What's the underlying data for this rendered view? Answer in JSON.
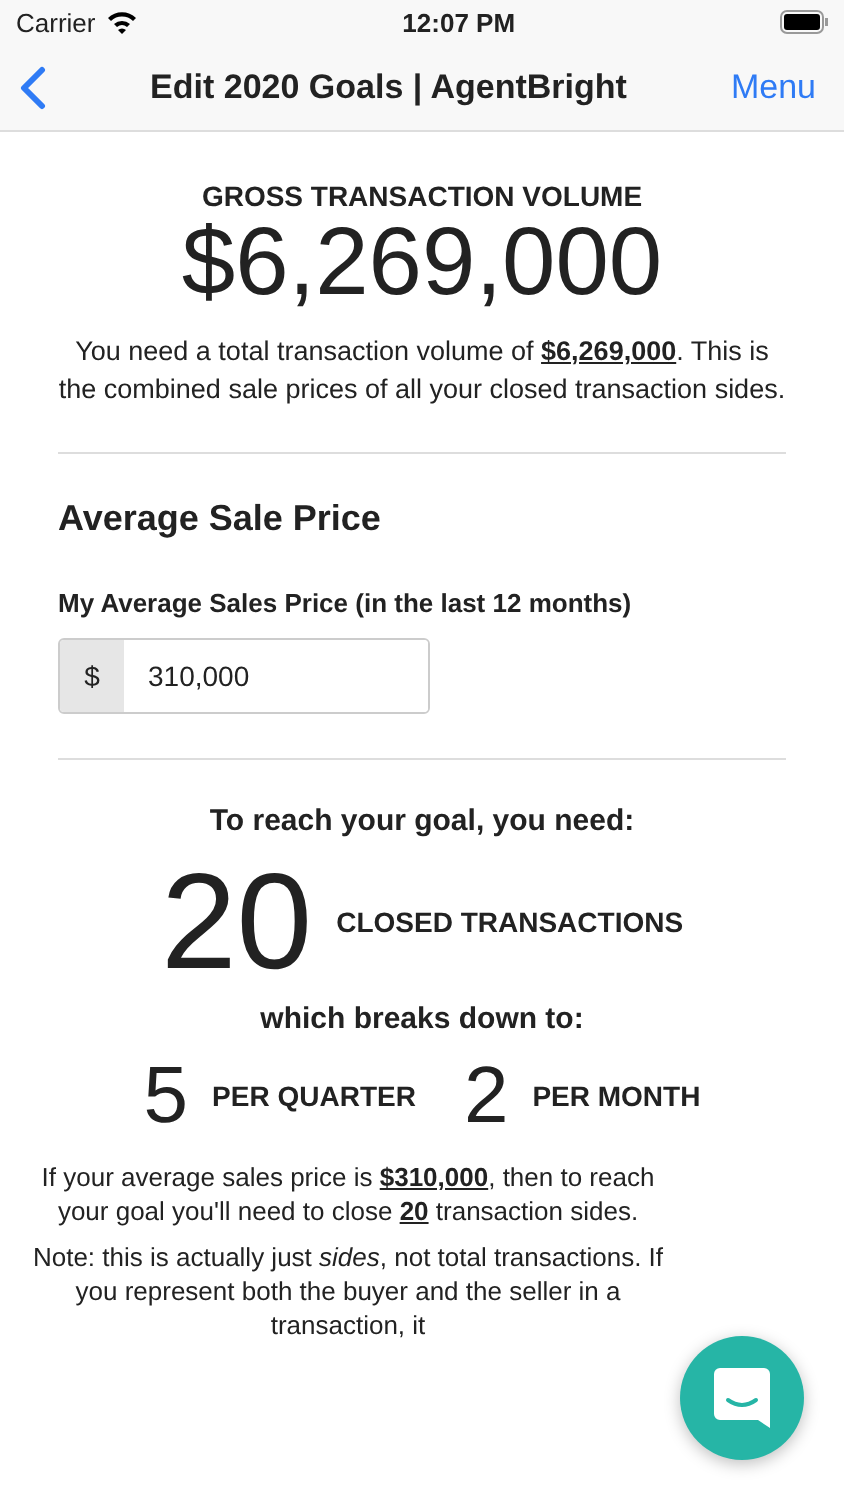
{
  "status_bar": {
    "carrier": "Carrier",
    "time": "12:07 PM"
  },
  "nav": {
    "title": "Edit 2020 Goals | AgentBright",
    "menu": "Menu"
  },
  "volume": {
    "label": "GROSS TRANSACTION VOLUME",
    "value": "$6,269,000",
    "text": [
      "You need a total transaction volume of ",
      "$6,269,000",
      ". This is the combined sale prices of all your closed transaction sides."
    ]
  },
  "average": {
    "heading": "Average Sale Price",
    "field_label": "My Average Sales Price (in the last 12 months)",
    "prefix": "$",
    "value": "310,000"
  },
  "goal": {
    "intro": "To reach your goal, you need:",
    "count": "20",
    "count_label": "CLOSED TRANSACTIONS",
    "breakdown": "which breaks down to:",
    "parts": [
      {
        "count": "5",
        "label": "PER QUARTER"
      },
      {
        "count": "2",
        "label": "PER MONTH"
      }
    ],
    "summary": [
      "If your average sales price is ",
      "$310,000",
      ", then to reach your goal you'll need to close ",
      "20",
      " transaction sides."
    ],
    "note": "Note: this is actually just *sides*, not total transactions. If you represent both the buyer and the seller in a transaction, it"
  }
}
